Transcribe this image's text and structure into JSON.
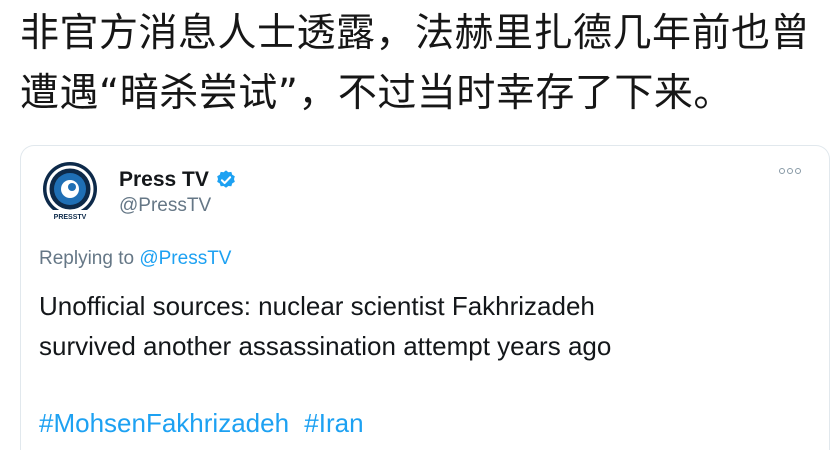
{
  "headline": {
    "line1": "非官方消息人士透露，法赫里扎德几年前也曾",
    "line2": "遭遇“暗杀尝试”，不过当时幸存了下来。"
  },
  "tweet": {
    "avatar_label": "PRESSTV",
    "display_name": "Press TV",
    "handle": "@PressTV",
    "replying_prefix": "Replying to",
    "replying_to": "@PressTV",
    "text_line1": "Unofficial sources: nuclear scientist Fakhrizadeh",
    "text_line2": "survived another assassination attempt years ago",
    "hashtags": [
      "#MohsenFakhrizadeh",
      "#Iran"
    ]
  },
  "colors": {
    "link": "#1da1f2",
    "secondary_text": "#657786",
    "verified": "#1da1f2"
  }
}
